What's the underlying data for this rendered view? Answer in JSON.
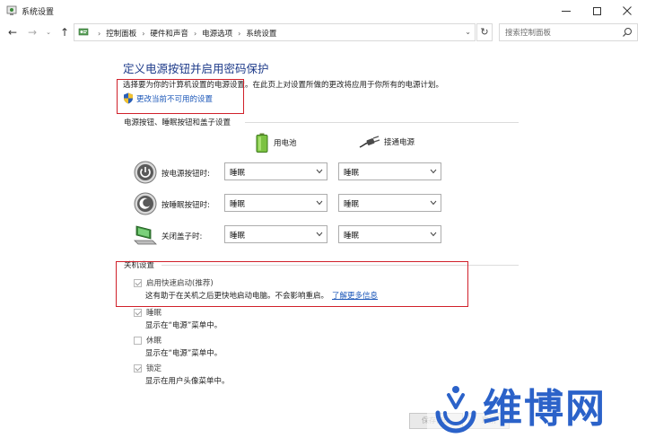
{
  "window": {
    "title": "系统设置"
  },
  "nav": {
    "back": "←",
    "forward": "→",
    "recent": "⌄",
    "up": "↑",
    "breadcrumbs": [
      "控制面板",
      "硬件和声音",
      "电源选项",
      "系统设置"
    ],
    "search_placeholder": "搜索控制面板"
  },
  "page": {
    "heading": "定义电源按钮并启用密码保护",
    "description": "选择要为你的计算机设置的电源设置。在此页上对设置所做的更改将应用于你所有的电源计划。",
    "change_unavailable_link": "更改当前不可用的设置",
    "power_section_label": "电源按钮、睡眠按钮和盖子设置",
    "column_battery": "用电池",
    "column_plugged": "接通电源",
    "rows": [
      {
        "label": "按电源按钮时:",
        "battery": "睡眠",
        "plugged": "睡眠",
        "icon": "power-button-icon"
      },
      {
        "label": "按睡眠按钮时:",
        "battery": "睡眠",
        "plugged": "睡眠",
        "icon": "sleep-button-icon"
      },
      {
        "label": "关闭盖子时:",
        "battery": "睡眠",
        "plugged": "睡眠",
        "icon": "laptop-lid-icon"
      }
    ],
    "shutdown_section_label": "关机设置",
    "shutdown_options": [
      {
        "label": "启用快速启动(推荐)",
        "checked": true,
        "description": "这有助于在关机之后更快地启动电脑。不会影响重启。",
        "link": "了解更多信息"
      },
      {
        "label": "睡眠",
        "checked": true,
        "description": "显示在“电源”菜单中。"
      },
      {
        "label": "休眠",
        "checked": false,
        "description": "显示在“电源”菜单中。"
      },
      {
        "label": "锁定",
        "checked": true,
        "description": "显示在用户头像菜单中。"
      }
    ]
  },
  "buttons": {
    "save": "保存修改",
    "cancel": "取消"
  },
  "watermark": {
    "text": "维博网"
  },
  "colors": {
    "heading": "#1e3b8a",
    "link": "#1a56b8",
    "highlight_box": "#d0202a",
    "watermark": "#2b62c9"
  }
}
